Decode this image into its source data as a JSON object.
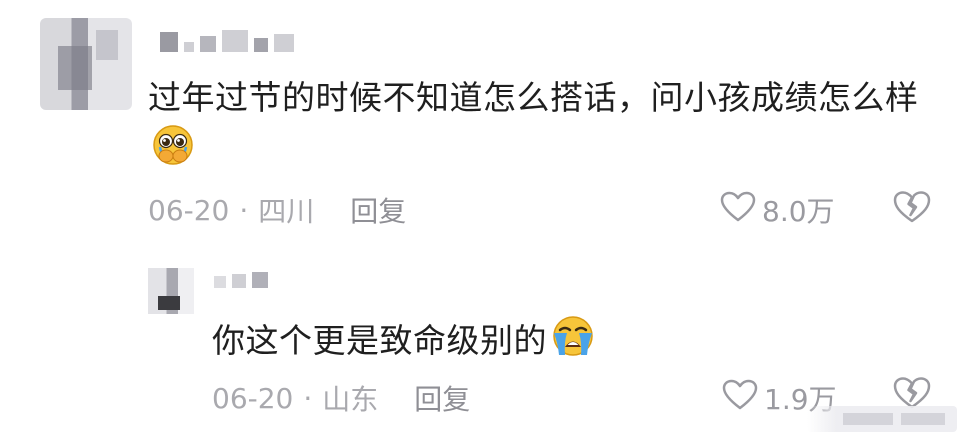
{
  "comments": [
    {
      "text": "过年过节的时候不知道怎么搭话，问小孩成绩怎么样",
      "emoji": "pleading-face-hands",
      "date": "06-20",
      "location": "四川",
      "separator": "·",
      "reply_label": "回复",
      "likes": "8.0万"
    },
    {
      "text": "你这个更是致命级别的",
      "emoji": "loudly-crying-face",
      "date": "06-20",
      "location": "山东",
      "separator": "·",
      "reply_label": "回复",
      "likes": "1.9万"
    }
  ],
  "colors": {
    "text": "#1f1f1f",
    "meta": "#a9a9ae",
    "icon": "#9a9aa0",
    "emoji_face": "#f7c53a",
    "emoji_tear": "#4aa3e8"
  }
}
